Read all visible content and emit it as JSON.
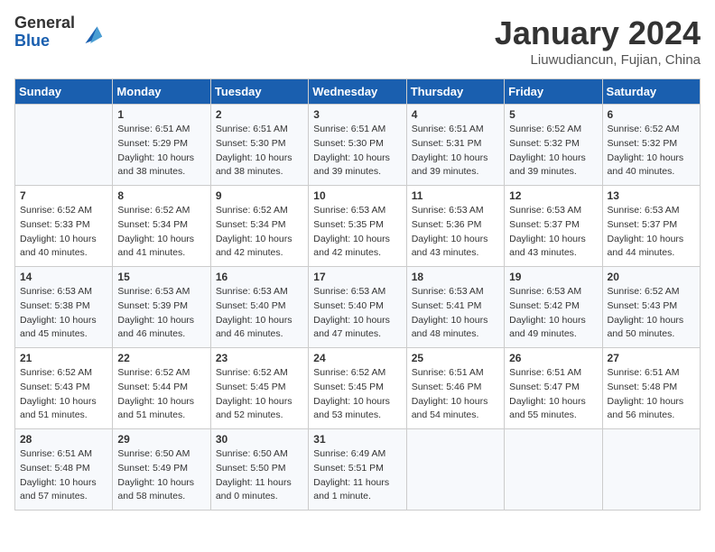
{
  "logo": {
    "general": "General",
    "blue": "Blue"
  },
  "title": "January 2024",
  "location": "Liuwudiancun, Fujian, China",
  "days_of_week": [
    "Sunday",
    "Monday",
    "Tuesday",
    "Wednesday",
    "Thursday",
    "Friday",
    "Saturday"
  ],
  "weeks": [
    [
      {
        "day": "",
        "info": ""
      },
      {
        "day": "1",
        "info": "Sunrise: 6:51 AM\nSunset: 5:29 PM\nDaylight: 10 hours\nand 38 minutes."
      },
      {
        "day": "2",
        "info": "Sunrise: 6:51 AM\nSunset: 5:30 PM\nDaylight: 10 hours\nand 38 minutes."
      },
      {
        "day": "3",
        "info": "Sunrise: 6:51 AM\nSunset: 5:30 PM\nDaylight: 10 hours\nand 39 minutes."
      },
      {
        "day": "4",
        "info": "Sunrise: 6:51 AM\nSunset: 5:31 PM\nDaylight: 10 hours\nand 39 minutes."
      },
      {
        "day": "5",
        "info": "Sunrise: 6:52 AM\nSunset: 5:32 PM\nDaylight: 10 hours\nand 39 minutes."
      },
      {
        "day": "6",
        "info": "Sunrise: 6:52 AM\nSunset: 5:32 PM\nDaylight: 10 hours\nand 40 minutes."
      }
    ],
    [
      {
        "day": "7",
        "info": "Sunrise: 6:52 AM\nSunset: 5:33 PM\nDaylight: 10 hours\nand 40 minutes."
      },
      {
        "day": "8",
        "info": "Sunrise: 6:52 AM\nSunset: 5:34 PM\nDaylight: 10 hours\nand 41 minutes."
      },
      {
        "day": "9",
        "info": "Sunrise: 6:52 AM\nSunset: 5:34 PM\nDaylight: 10 hours\nand 42 minutes."
      },
      {
        "day": "10",
        "info": "Sunrise: 6:53 AM\nSunset: 5:35 PM\nDaylight: 10 hours\nand 42 minutes."
      },
      {
        "day": "11",
        "info": "Sunrise: 6:53 AM\nSunset: 5:36 PM\nDaylight: 10 hours\nand 43 minutes."
      },
      {
        "day": "12",
        "info": "Sunrise: 6:53 AM\nSunset: 5:37 PM\nDaylight: 10 hours\nand 43 minutes."
      },
      {
        "day": "13",
        "info": "Sunrise: 6:53 AM\nSunset: 5:37 PM\nDaylight: 10 hours\nand 44 minutes."
      }
    ],
    [
      {
        "day": "14",
        "info": "Sunrise: 6:53 AM\nSunset: 5:38 PM\nDaylight: 10 hours\nand 45 minutes."
      },
      {
        "day": "15",
        "info": "Sunrise: 6:53 AM\nSunset: 5:39 PM\nDaylight: 10 hours\nand 46 minutes."
      },
      {
        "day": "16",
        "info": "Sunrise: 6:53 AM\nSunset: 5:40 PM\nDaylight: 10 hours\nand 46 minutes."
      },
      {
        "day": "17",
        "info": "Sunrise: 6:53 AM\nSunset: 5:40 PM\nDaylight: 10 hours\nand 47 minutes."
      },
      {
        "day": "18",
        "info": "Sunrise: 6:53 AM\nSunset: 5:41 PM\nDaylight: 10 hours\nand 48 minutes."
      },
      {
        "day": "19",
        "info": "Sunrise: 6:53 AM\nSunset: 5:42 PM\nDaylight: 10 hours\nand 49 minutes."
      },
      {
        "day": "20",
        "info": "Sunrise: 6:52 AM\nSunset: 5:43 PM\nDaylight: 10 hours\nand 50 minutes."
      }
    ],
    [
      {
        "day": "21",
        "info": "Sunrise: 6:52 AM\nSunset: 5:43 PM\nDaylight: 10 hours\nand 51 minutes."
      },
      {
        "day": "22",
        "info": "Sunrise: 6:52 AM\nSunset: 5:44 PM\nDaylight: 10 hours\nand 51 minutes."
      },
      {
        "day": "23",
        "info": "Sunrise: 6:52 AM\nSunset: 5:45 PM\nDaylight: 10 hours\nand 52 minutes."
      },
      {
        "day": "24",
        "info": "Sunrise: 6:52 AM\nSunset: 5:45 PM\nDaylight: 10 hours\nand 53 minutes."
      },
      {
        "day": "25",
        "info": "Sunrise: 6:51 AM\nSunset: 5:46 PM\nDaylight: 10 hours\nand 54 minutes."
      },
      {
        "day": "26",
        "info": "Sunrise: 6:51 AM\nSunset: 5:47 PM\nDaylight: 10 hours\nand 55 minutes."
      },
      {
        "day": "27",
        "info": "Sunrise: 6:51 AM\nSunset: 5:48 PM\nDaylight: 10 hours\nand 56 minutes."
      }
    ],
    [
      {
        "day": "28",
        "info": "Sunrise: 6:51 AM\nSunset: 5:48 PM\nDaylight: 10 hours\nand 57 minutes."
      },
      {
        "day": "29",
        "info": "Sunrise: 6:50 AM\nSunset: 5:49 PM\nDaylight: 10 hours\nand 58 minutes."
      },
      {
        "day": "30",
        "info": "Sunrise: 6:50 AM\nSunset: 5:50 PM\nDaylight: 11 hours\nand 0 minutes."
      },
      {
        "day": "31",
        "info": "Sunrise: 6:49 AM\nSunset: 5:51 PM\nDaylight: 11 hours\nand 1 minute."
      },
      {
        "day": "",
        "info": ""
      },
      {
        "day": "",
        "info": ""
      },
      {
        "day": "",
        "info": ""
      }
    ]
  ]
}
